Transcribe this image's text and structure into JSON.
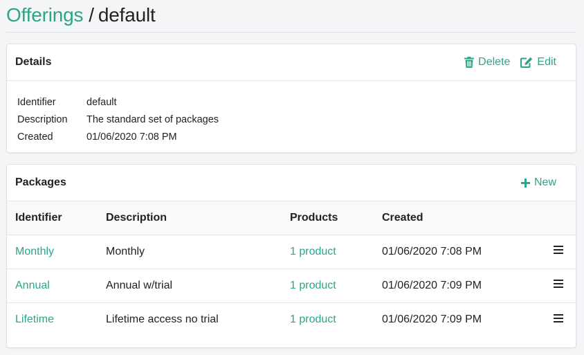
{
  "breadcrumb": {
    "parent": "Offerings",
    "separator": "/",
    "current": "default"
  },
  "details": {
    "title": "Details",
    "delete_label": "Delete",
    "edit_label": "Edit",
    "rows": [
      {
        "key": "Identifier",
        "value": "default"
      },
      {
        "key": "Description",
        "value": "The standard set of packages"
      },
      {
        "key": "Created",
        "value": "01/06/2020 7:08 PM"
      }
    ]
  },
  "packages": {
    "title": "Packages",
    "new_label": "New",
    "columns": [
      "Identifier",
      "Description",
      "Products",
      "Created"
    ],
    "rows": [
      {
        "identifier": "Monthly",
        "description": "Monthly",
        "products": "1 product",
        "created": "01/06/2020 7:08 PM"
      },
      {
        "identifier": "Annual",
        "description": "Annual w/trial",
        "products": "1 product",
        "created": "01/06/2020 7:09 PM"
      },
      {
        "identifier": "Lifetime",
        "description": "Lifetime access no trial",
        "products": "1 product",
        "created": "01/06/2020 7:09 PM"
      }
    ]
  },
  "colors": {
    "accent": "#2aa58a",
    "text": "#222222",
    "border": "#dfe2e6",
    "background": "#f4f5f7"
  },
  "icons": {
    "delete": "trash-icon",
    "edit": "edit-icon",
    "new": "plus-icon",
    "row_menu": "hamburger-menu-icon"
  }
}
